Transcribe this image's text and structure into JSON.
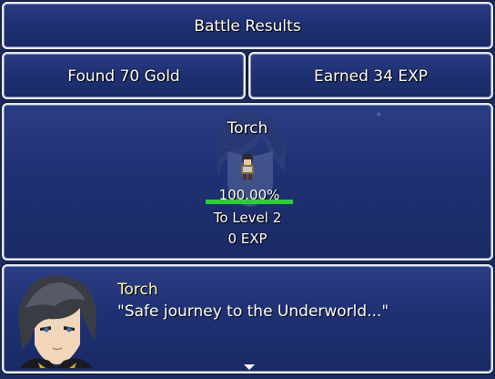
{
  "title_window": {
    "text": "Battle Results"
  },
  "rewards": {
    "gold_text": "Found 70 Gold",
    "exp_text": "Earned 34 EXP"
  },
  "actor": {
    "name": "Torch",
    "gauge_text": "100.00%",
    "gauge_percent": 100,
    "to_level_text": "To Level 2",
    "exp_remaining_text": "0 EXP"
  },
  "message": {
    "speaker": "Torch",
    "line": "\"Safe journey to the Underworld...\""
  },
  "colors": {
    "window_bg": "#1f3173",
    "gauge_fill": "#22d62a",
    "speaker_text": "#fff8b0"
  }
}
